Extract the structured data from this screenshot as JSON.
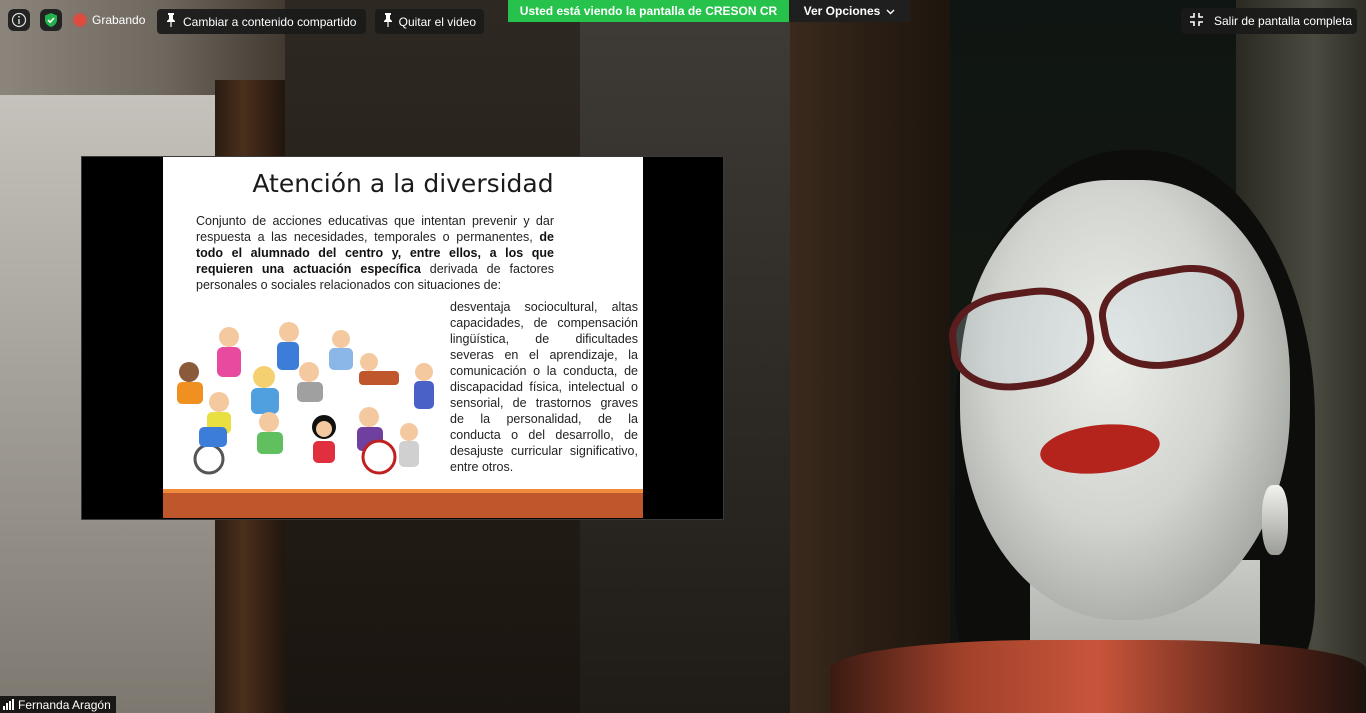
{
  "toolbar": {
    "info_icon": "info-icon",
    "security_icon": "shield-check-icon",
    "recording_label": "Grabando",
    "switch_content_label": "Cambiar a contenido compartido",
    "remove_video_label": "Quitar el video"
  },
  "banner": {
    "prefix": "Usted está viendo la pantalla de ",
    "presenter": "CRESON CR",
    "color": "#27c24c"
  },
  "view_options": {
    "label": "Ver Opciones"
  },
  "fullscreen": {
    "label": "Salir de pantalla completa"
  },
  "slide": {
    "title": "Atención a la diversidad",
    "intro_normal_1": "Conjunto de acciones educativas que intentan prevenir y dar respuesta a las necesidades, temporales o permanentes, ",
    "intro_bold": "de todo el alumnado del centro y, entre ellos, a los que requieren una actuación específica",
    "intro_normal_2": " derivada de factores personales o sociales relacionados con situaciones de:",
    "list_text": "desventaja sociocultural, altas capacidades, de compensación lingüística, de dificultades severas en el aprendizaje, la comunicación o la conducta, de discapacidad física, intelectual o sensorial, de trastornos graves de la personalidad, de la conducta o del desarrollo, de desajuste curricular significativo, entre otros.",
    "accent_colors": [
      "#f08a3c",
      "#c0562b"
    ]
  },
  "participant": {
    "name": "Fernanda Aragón"
  }
}
